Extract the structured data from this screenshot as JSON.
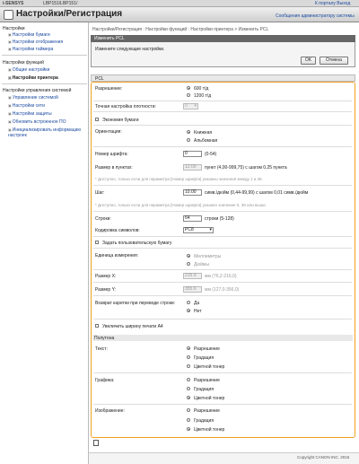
{
  "topbar": {
    "logo": "i-SENSYS",
    "model": "LBP151/LBP151/",
    "portal": "К порталу",
    "logout": "Выход"
  },
  "app": {
    "title": "Настройки/Регистрация",
    "admin_msg": "Сообщения администратору системы"
  },
  "sidebar": {
    "sections": [
      {
        "title": "Настройки",
        "items": [
          "Настройки бумаги",
          "Настройки отображения",
          "Настройки таймера"
        ]
      },
      {
        "title": "Настройки функций",
        "items": [
          "Общие настройки",
          "Настройки принтера"
        ]
      },
      {
        "title": "Настройки управления системой",
        "items": [
          "Управление системой",
          "Настройки сети",
          "Настройки защиты",
          "Обновить встроенное ПО",
          "Инициализировать информацию настроек"
        ]
      }
    ]
  },
  "breadcrumb": "Настройки/Регистрация : Настройки функций : Настройки принтера > Изменить PCL",
  "header": {
    "title": "Изменить PCL",
    "message": "Измените следующие настройки.",
    "ok": "OK",
    "cancel": "Отмена"
  },
  "section_title": "PCL",
  "form": {
    "resolution_label": "Разрешение:",
    "res_600": "600 т/д",
    "res_1200": "1200 т/д",
    "density_label": "Точная настройка плотности:",
    "density_value": "0",
    "economy_label": "Экономия бумаги",
    "orientation_label": "Ориентация:",
    "portrait": "Книжная",
    "landscape": "Альбомная",
    "font_number_label": "Номер шрифта:",
    "font_number_value": "0",
    "font_number_range": "(0-54)",
    "point_size_label": "Размер в пунктах:",
    "point_size_value": "12.00",
    "point_size_hint": "пункт (4,00-999,75) с шагом 0,25 пункта",
    "point_size_note": "* Доступно, только если для параметра [Номер шрифта] указаны значения между 1 и 36.",
    "pitch_label": "Шаг:",
    "pitch_value": "10.00",
    "pitch_hint": "симв./дюйм (0,44-99,99) с шагом 0,01 симв./дюйм",
    "pitch_note": "* Доступно, только если для параметра [Номер шрифта] указано значение 0, 39 или выше.",
    "lines_label": "Строки:",
    "lines_value": "64",
    "lines_hint": "строки (5-128)",
    "charset_label": "Кодировка символов:",
    "charset_value": "PC8",
    "custom_paper_label": "Задать пользовательскую бумагу",
    "unit_label": "Единица измерения:",
    "mm": "Миллиметры",
    "inch": "Дюймы",
    "size_x_label": "Размер X:",
    "size_x_value": "215.9",
    "size_x_hint": "мм (76,2-216,0)",
    "size_y_label": "Размер Y:",
    "size_y_value": "355.6",
    "size_y_hint": "мм (127,0-356,0)",
    "cr_label": "Возврат каретки при переводе строки:",
    "yes": "Да",
    "no": "Нет",
    "a4_width_label": "Увеличить ширину печати A4"
  },
  "halftone": {
    "title": "Полутона",
    "groups": [
      {
        "label": "Текст:",
        "options": [
          "Разрешение",
          "Градация",
          "Цветной тонер"
        ],
        "selected": 0
      },
      {
        "label": "Графика:",
        "options": [
          "Разрешение",
          "Градация",
          "Цветной тонер"
        ],
        "selected": 2
      },
      {
        "label": "Изображение:",
        "options": [
          "Разрешение",
          "Градация",
          "Цветной тонер"
        ],
        "selected": 2
      }
    ]
  },
  "footer": {
    "copyright": "Copyright CANON INC. 2015"
  }
}
